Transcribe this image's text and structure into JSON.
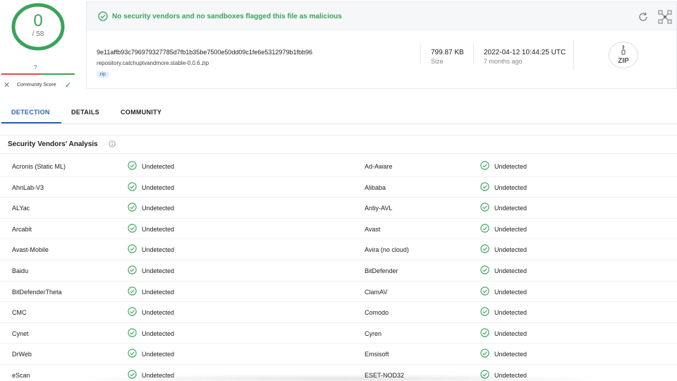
{
  "score": {
    "detections": "0",
    "total": "/ 58",
    "community_value": "?",
    "community_label": "Community Score"
  },
  "banner": {
    "text": "No security vendors and no sandboxes flagged this file as malicious"
  },
  "file": {
    "hash": "9e11affb93c796979327785d7fb1b35be7500e50dd09c1fe6e5312979b1fbb96",
    "name": "repository.catchuptvandmore.stable-0.0.6.zip",
    "tag": "zip",
    "size_value": "799.87 KB",
    "size_label": "Size",
    "date_value": "2022-04-12 10:44:25 UTC",
    "date_label": "7 months ago",
    "type_icon_label": "ZIP"
  },
  "tabs": [
    {
      "label": "DETECTION"
    },
    {
      "label": "DETAILS"
    },
    {
      "label": "COMMUNITY"
    }
  ],
  "section": {
    "title": "Security Vendors' Analysis"
  },
  "vendors": [
    {
      "left": "Acronis (Static ML)",
      "left_result": "Undetected",
      "right": "Ad-Aware",
      "right_result": "Undetected"
    },
    {
      "left": "AhnLab-V3",
      "left_result": "Undetected",
      "right": "Alibaba",
      "right_result": "Undetected"
    },
    {
      "left": "ALYac",
      "left_result": "Undetected",
      "right": "Antiy-AVL",
      "right_result": "Undetected"
    },
    {
      "left": "Arcabit",
      "left_result": "Undetected",
      "right": "Avast",
      "right_result": "Undetected"
    },
    {
      "left": "Avast-Mobile",
      "left_result": "Undetected",
      "right": "Avira (no cloud)",
      "right_result": "Undetected"
    },
    {
      "left": "Baidu",
      "left_result": "Undetected",
      "right": "BitDefender",
      "right_result": "Undetected"
    },
    {
      "left": "BitDefenderTheta",
      "left_result": "Undetected",
      "right": "ClamAV",
      "right_result": "Undetected"
    },
    {
      "left": "CMC",
      "left_result": "Undetected",
      "right": "Comodo",
      "right_result": "Undetected"
    },
    {
      "left": "Cynet",
      "left_result": "Undetected",
      "right": "Cyren",
      "right_result": "Undetected"
    },
    {
      "left": "DrWeb",
      "left_result": "Undetected",
      "right": "Emsisoft",
      "right_result": "Undetected"
    },
    {
      "left": "eScan",
      "left_result": "Undetected",
      "right": "ESET-NOD32",
      "right_result": "Undetected"
    }
  ],
  "colors": {
    "clean_green": "#3aa35a",
    "accent_blue": "#2a63b8",
    "danger_red": "#e04b4b"
  },
  "icons": [
    "check-circle-icon",
    "reload-icon",
    "graph-icon",
    "info-icon",
    "zip-file-icon",
    "close-icon",
    "checkmark-icon"
  ]
}
